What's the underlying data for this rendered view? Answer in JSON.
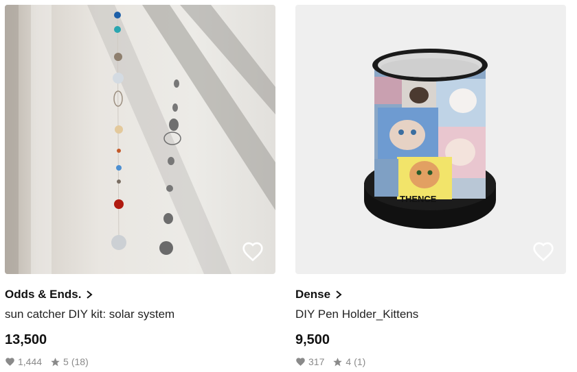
{
  "products": [
    {
      "shop_name": "Odds & Ends.",
      "title": "sun catcher DIY kit: solar system",
      "price": "13,500",
      "likes": "1,444",
      "rating": "5",
      "review_count": "(18)",
      "image_icon": "sun-catcher-photo"
    },
    {
      "shop_name": "Dense",
      "title": "DIY Pen Holder_Kittens",
      "price": "9,500",
      "likes": "317",
      "rating": "4",
      "review_count": "(1)",
      "image_icon": "pen-holder-photo",
      "image_label": "THENCE"
    }
  ],
  "icons": {
    "favorite": "heart-outline-icon",
    "likes": "heart-icon",
    "rating": "star-icon",
    "shop_arrow": "chevron-right-icon"
  },
  "colors": {
    "meta_gray": "#8a8a8a",
    "text": "#111111"
  }
}
